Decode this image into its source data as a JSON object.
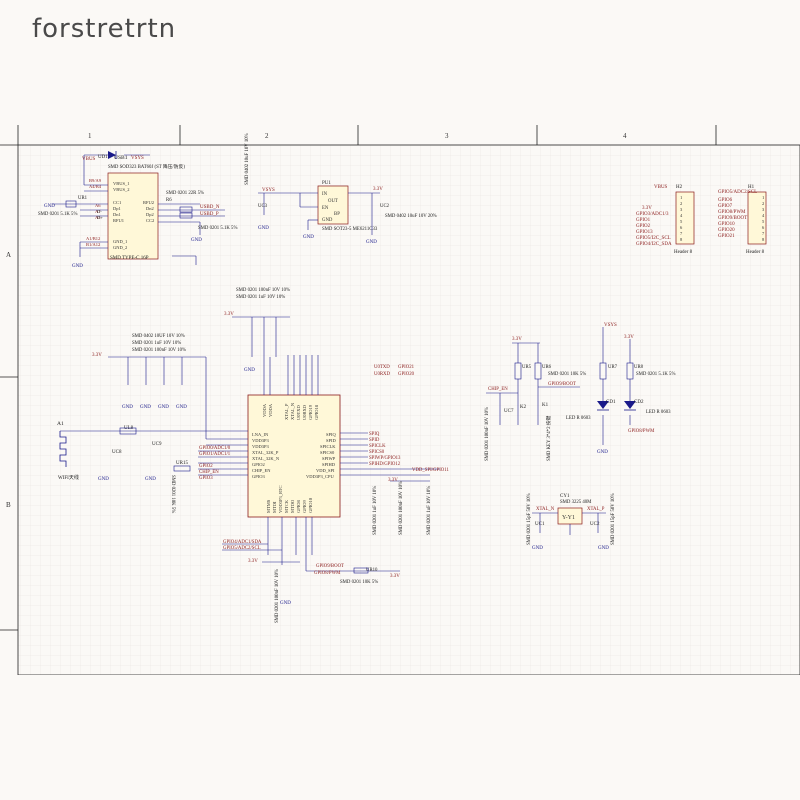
{
  "brand": "forstretrtn",
  "sheet": {
    "columns": [
      "1",
      "2",
      "3",
      "4"
    ],
    "rows": [
      "A",
      "B"
    ]
  },
  "usb": {
    "ref": "USB1",
    "part": "SMD TYPE-C 16P",
    "pins_left": [
      "B9/A9",
      "A4/B4",
      "A6",
      "A7",
      "A5",
      "A1/B12",
      "B1/A12"
    ],
    "pins_right": [
      "VBUS_1",
      "VBUS_2",
      "CC1",
      "Dp1",
      "Dn1",
      "RFU1",
      "GND_1",
      "GND_2",
      "RFU2",
      "Dn2",
      "Dp2",
      "CC2"
    ],
    "net_labels": [
      "D-",
      "D+",
      "GND"
    ],
    "resistors": [
      "UR1",
      "UR4",
      "R6"
    ],
    "resistor_value": "SMD 0201 5.1K 5%",
    "diode": "UD1",
    "diode_part": "SMD SOD323 BAT60J (ST 降压/防反)",
    "series_r": "SMD 0201 22R 5%",
    "usb_nets": [
      "USBD_N",
      "USBD_P"
    ],
    "vbus_labels": [
      "VBUS",
      "VSYS"
    ]
  },
  "ldo": {
    "ref": "PU1",
    "part": "SMD SOT23-5 ME6211C33",
    "pins": [
      "IN",
      "OUT",
      "EN",
      "BP",
      "GND"
    ],
    "cap_in": "SMD 0402 10uF 10V 10%",
    "cap_out": "SMD 0402 10uF 10V 20%",
    "cap_refs": [
      "UC3",
      "UC2"
    ],
    "nets": [
      "VSYS",
      "3.3V"
    ]
  },
  "headers": {
    "h2_ref": "H2",
    "h2_title": "Header 8",
    "h2_pins": [
      "VBUS",
      "3.3V",
      "GPIO3/ADC1/3",
      "GPIO1",
      "GPIO2",
      "GPIO13",
      "GPIO5/I2C_SCL",
      "GPIO4/I2C_SDA"
    ],
    "h1_ref": "H1",
    "h1_title": "Header 8",
    "h1_pins": [
      "GPIO5/ADC2/SCL",
      "GPIO6",
      "GPIO7",
      "GPIO8/PWM",
      "GPIO9/BOOT",
      "GPIO10",
      "GPIO20",
      "GPIO21"
    ],
    "pin_numbers": [
      "1",
      "2",
      "3",
      "4",
      "5",
      "6",
      "7",
      "8"
    ]
  },
  "mcu": {
    "top_caps": "SMD 0201 100nF 10V 10%",
    "top_caps2": "SMD 0201 1uF 10V 10%",
    "cap_notes": [
      "SMD 0402 10UF 10V 10%",
      "SMD 0201 1uF 10V 10%",
      "SMD 0201 100nF 10V 10%"
    ],
    "pins_left": [
      "LNA_IN",
      "VDD3P3",
      "VDD3P3",
      "XTAL_32K_P",
      "XTAL_32K_N",
      "GPIO2",
      "CHIP_EN",
      "GPIO3"
    ],
    "pins_right": [
      "SPIQ",
      "SPID",
      "SPICLK",
      "SPICS0",
      "SPIWP",
      "SPIHD",
      "VDD_SPI",
      "VDD3P3_CPU"
    ],
    "pins_top": [
      "VDDA",
      "VDDA",
      "XTAL_P",
      "XTAL_N",
      "U0TXD",
      "U0RXD",
      "GPIO19",
      "GPIO18"
    ],
    "pins_bottom": [
      "MTMS",
      "MTDI",
      "VDD3P3_RTC",
      "MTCK",
      "MTDO",
      "GPIO8",
      "GPIO9",
      "GPIO10"
    ],
    "left_nets": [
      "GPIO0/ADC1/0",
      "GPIO1/ADC1/1",
      "GPIO2",
      "CHIP_EN",
      "GPIO3"
    ],
    "right_nets": [
      "SPIQ",
      "SPID",
      "SPICLK",
      "SPICS0",
      "SPIWP/GPIO13",
      "SPIHD/GPIO12",
      "VDD_SPI/GPIO11"
    ],
    "bottom_nets": [
      "GPIO4/ADC1/SDA",
      "GPIO5/ADC2/SCL"
    ],
    "boot_nets": [
      "GPIO9/BOOT",
      "GPIO8/PWM"
    ],
    "top_nets": [
      "U0TXD",
      "U0RXD",
      "GPIO19",
      "GPIO20"
    ],
    "uart_labels": [
      "U0TXD",
      "GPIO21",
      "U0RXD",
      "GPIO20"
    ],
    "bottom_caps": [
      "SMD 0201 1uF 10V 10%",
      "SMD 0201 100nF 10V 10%",
      "SMD 0201 1uF 10V 10%"
    ],
    "ur10": "UR10",
    "ur10_value": "SMD 0201 10K 5%",
    "cap_100n": "SMD 0201 100nF 10V 10%",
    "nets_33": "3.3V"
  },
  "antenna": {
    "ref": "A1",
    "label": "WIFI天线",
    "l": "UL8",
    "c": [
      "UC8",
      "UC9"
    ],
    "ur15": "UR15",
    "ur15_value": "SMD 0201 10K 5%"
  },
  "reset": {
    "nets": [
      "3.3V",
      "CHIP_EN",
      "GPIO9/BOOT"
    ],
    "resistors": [
      "UR5",
      "UR6"
    ],
    "r_value": "SMD 0201 10K 5%",
    "keys": [
      "K2",
      "K1"
    ],
    "cap": "UC7",
    "cap_value": "SMD 0201 100nF 10V 10%",
    "key_part": "SMD KEY 3*4*2 按键"
  },
  "leds": {
    "nets": [
      "VSYS",
      "3.3V"
    ],
    "resistors": [
      "UR7",
      "UR8"
    ],
    "r_value": "SMD 0201 5.1K 5%",
    "refs": [
      "CD1",
      "CD2"
    ],
    "led_part": "LED R 0603",
    "gpio": "GPIO8/PWM"
  },
  "crystal": {
    "ref": "CY1",
    "part": "SMD 3225 40M",
    "caps": [
      "UC1",
      "UC2"
    ],
    "cap_value": "SMD 0201 15pF 50V 10%",
    "nets": [
      "XTAL_N",
      "XTAL_P"
    ]
  },
  "gnd": "GND"
}
